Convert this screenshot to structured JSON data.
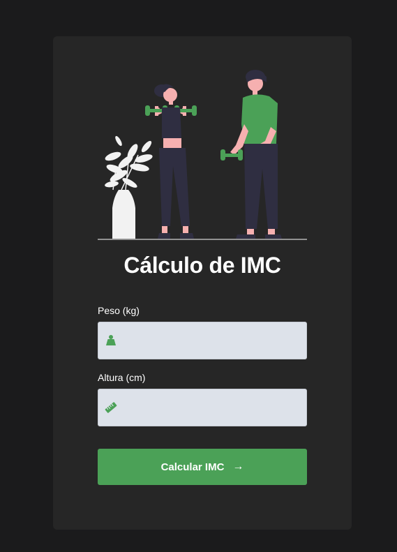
{
  "colors": {
    "page_background": "#1b1b1c",
    "card_background": "#262626",
    "accent": "#4ba157",
    "input_background": "#dde2ea"
  },
  "card": {
    "illustration_icon": "fitness-people-illustration",
    "title": "Cálculo de IMC",
    "fields": [
      {
        "label": "Peso (kg)",
        "icon": "weight-icon",
        "value": "",
        "placeholder": ""
      },
      {
        "label": "Altura (cm)",
        "icon": "ruler-icon",
        "value": "",
        "placeholder": ""
      }
    ],
    "submit": {
      "label": "Calcular IMC",
      "icon": "arrow-right-icon"
    }
  }
}
